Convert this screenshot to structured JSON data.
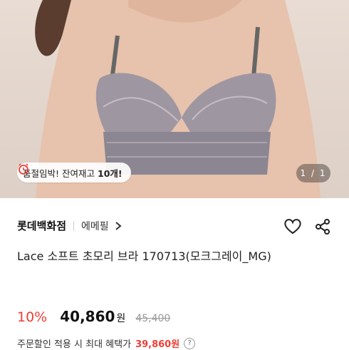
{
  "hero": {
    "stock_badge": {
      "text": "품절임박! 잔여재고",
      "count": "10개!"
    },
    "image_counter": "1 / 1"
  },
  "store": {
    "name": "롯데백화점",
    "brand": "에메필"
  },
  "product": {
    "title": "Lace 소프트 초모리 브라 170713(모크그레이_MG)"
  },
  "price": {
    "discount": "10%",
    "amount": "40,860",
    "currency": "원",
    "original": "45,400"
  },
  "coupon": {
    "text": "주문할인 적용 시 최대 혜택가",
    "best_price": "39,860원",
    "help": "?"
  },
  "icons": {
    "wishlist": "heart-icon",
    "share": "share-icon",
    "alarm": "alarm-clock-icon"
  },
  "colors": {
    "accent": "#ef3e36"
  }
}
